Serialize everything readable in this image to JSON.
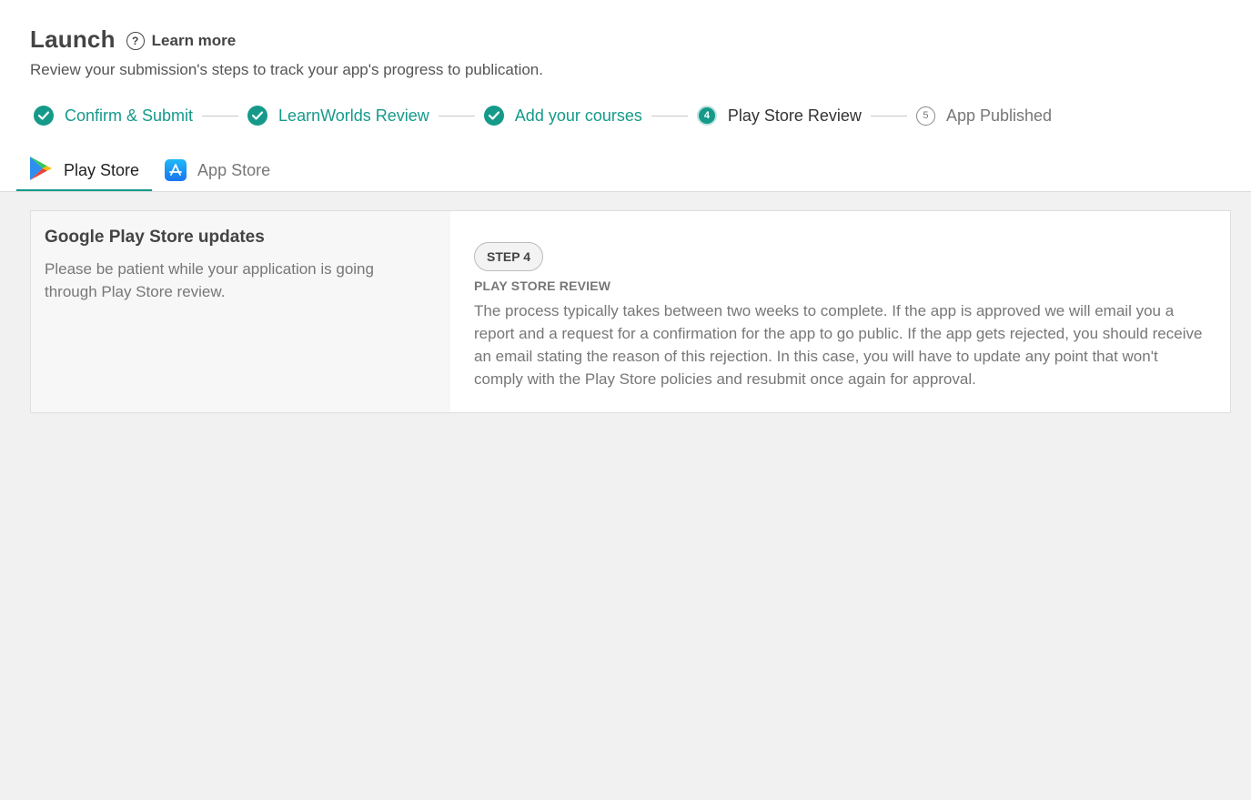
{
  "header": {
    "title": "Launch",
    "learn_more": "Learn more",
    "subtitle": "Review your submission's steps to track your app's progress to publication."
  },
  "stepper": {
    "steps": [
      {
        "label": "Confirm & Submit",
        "state": "done"
      },
      {
        "label": "LearnWorlds Review",
        "state": "done"
      },
      {
        "label": "Add your courses",
        "state": "done"
      },
      {
        "label": "Play Store Review",
        "state": "current",
        "number": "4"
      },
      {
        "label": "App Published",
        "state": "future",
        "number": "5"
      }
    ]
  },
  "tabs": [
    {
      "label": "Play Store",
      "icon": "google-play-icon",
      "active": true
    },
    {
      "label": "App Store",
      "icon": "app-store-icon",
      "active": false
    }
  ],
  "card": {
    "left_heading": "Google Play Store updates",
    "left_description": "Please be patient while your application is going through Play Store review.",
    "step_badge": "STEP 4",
    "review_title": "PLAY STORE REVIEW",
    "review_body": "The process typically takes between two weeks to complete. If the app is approved we will email you a report and a request for a confirmation for the app to go public. If the app gets rejected, you should receive an email stating the reason of this rejection. In this case, you will have to update any point that won't comply with the Play Store policies and resubmit once again for approval."
  },
  "colors": {
    "accent": "#159a8a",
    "background": "#f1f1f1"
  }
}
